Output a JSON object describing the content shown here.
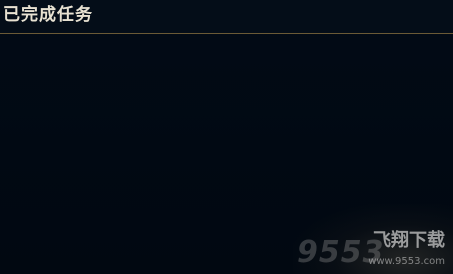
{
  "panel": {
    "title": "已完成任务"
  },
  "watermark": {
    "number": "9553",
    "brand": "飞翔下载",
    "url": "www.9553.com"
  }
}
